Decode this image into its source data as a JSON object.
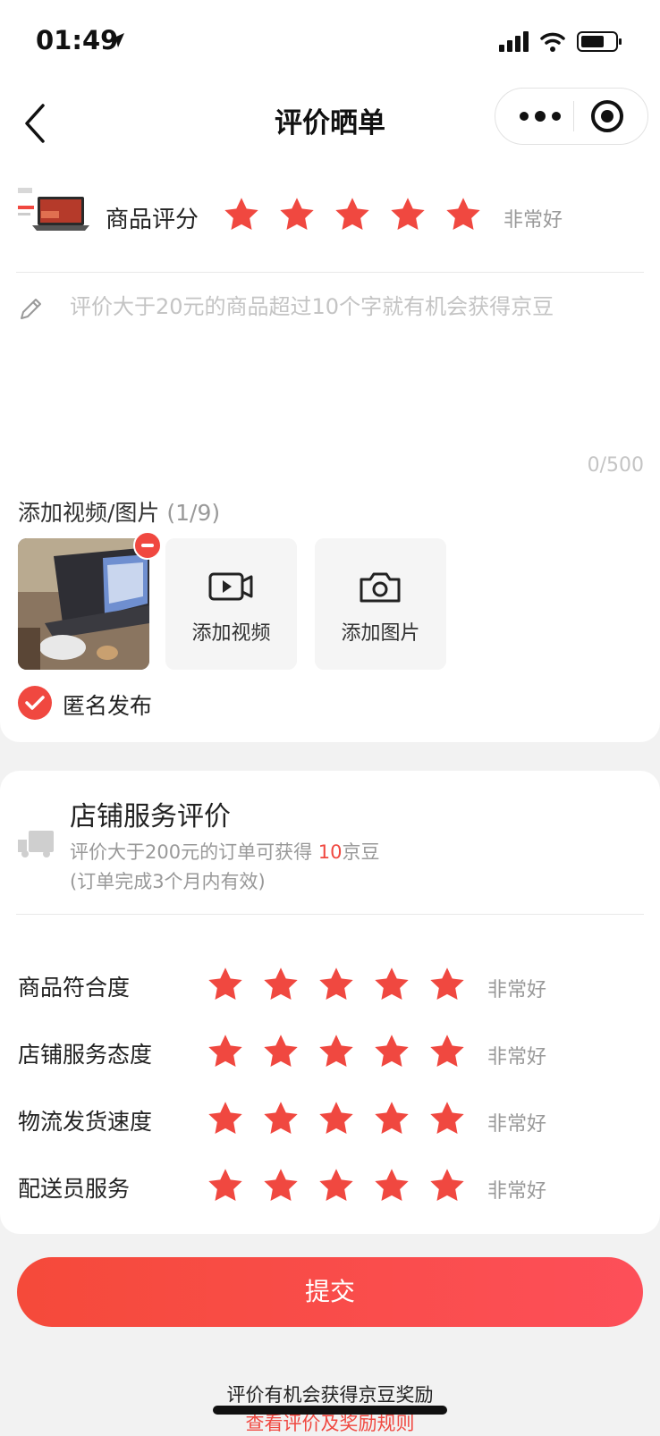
{
  "status_bar": {
    "time": "01:49"
  },
  "nav": {
    "title": "评价晒单"
  },
  "product": {
    "rating_label": "商品评分",
    "stars": 5,
    "rating_text": "非常好"
  },
  "review": {
    "placeholder": "评价大于20元的商品超过10个字就有机会获得京豆",
    "counter": "0/500"
  },
  "media": {
    "title": "添加视频/图片",
    "count": "(1/9)",
    "add_video_label": "添加视频",
    "add_image_label": "添加图片"
  },
  "anonymous": {
    "label": "匿名发布",
    "checked": true
  },
  "store_rating": {
    "title": "店铺服务评价",
    "subtitle_prefix": "评价大于200元的订单可获得 ",
    "subtitle_highlight": "10",
    "subtitle_suffix": "京豆",
    "subtitle_note": "(订单完成3个月内有效)",
    "rows": [
      {
        "label": "商品符合度",
        "stars": 5,
        "rating_text": "非常好"
      },
      {
        "label": "店铺服务态度",
        "stars": 5,
        "rating_text": "非常好"
      },
      {
        "label": "物流发货速度",
        "stars": 5,
        "rating_text": "非常好"
      },
      {
        "label": "配送员服务",
        "stars": 5,
        "rating_text": "非常好"
      }
    ]
  },
  "submit": {
    "label": "提交"
  },
  "footer": {
    "line1": "评价有机会获得京豆奖励",
    "line2": "查看评价及奖励规则"
  },
  "colors": {
    "accent": "#f04840",
    "star": "#f04840",
    "placeholder": "#c4c4c4"
  }
}
